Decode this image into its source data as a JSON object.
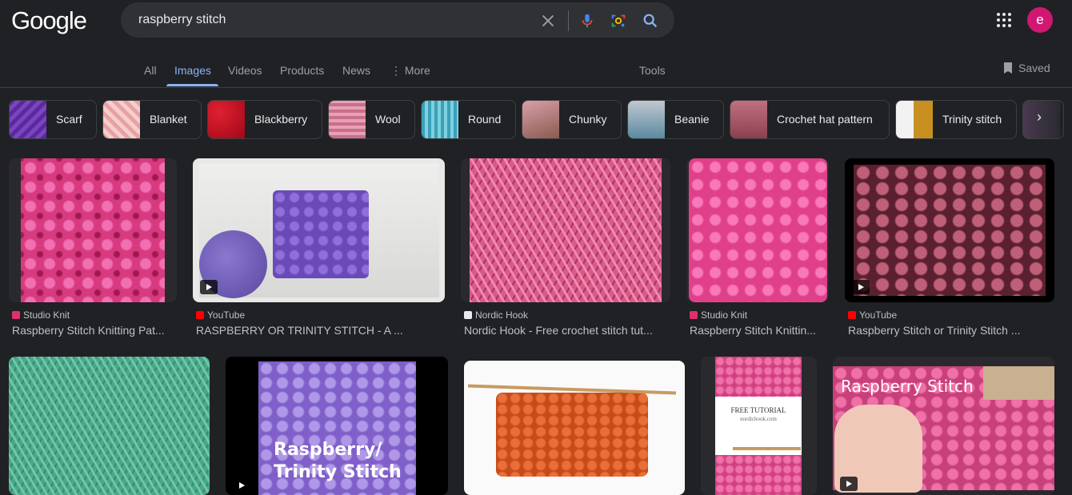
{
  "header": {
    "logo": "Google",
    "search_value": "raspberry stitch",
    "avatar_letter": "e"
  },
  "tabs": [
    "All",
    "Images",
    "Videos",
    "Products",
    "News",
    "More"
  ],
  "tools_label": "Tools",
  "saved_label": "Saved",
  "chips": [
    "Scarf",
    "Blanket",
    "Blackberry",
    "Wool",
    "Round",
    "Chunky",
    "Beanie",
    "Crochet hat pattern",
    "Trinity stitch"
  ],
  "results": [
    {
      "source": "Studio Knit",
      "title": "Raspberry Stitch Knitting Pat..."
    },
    {
      "source": "YouTube",
      "title": "RASPBERRY OR TRINITY STITCH - A ..."
    },
    {
      "source": "Nordic Hook",
      "title": "Nordic Hook - Free crochet stitch tut..."
    },
    {
      "source": "Studio Knit",
      "title": "Raspberry Stitch Knittin..."
    },
    {
      "source": "YouTube",
      "title": "Raspberry Stitch or Trinity Stitch ..."
    }
  ],
  "overlays": {
    "r2_2_line1": "Raspberry/",
    "r2_2_line2": "Trinity Stitch",
    "r2_4_line1": "FREE TUTORIAL",
    "r2_4_line2": "nordichook.com",
    "r2_5": "Raspberry Stitch"
  },
  "colors": {
    "background": "#202124",
    "accent": "#8ab4f8",
    "avatar": "#d01873"
  }
}
